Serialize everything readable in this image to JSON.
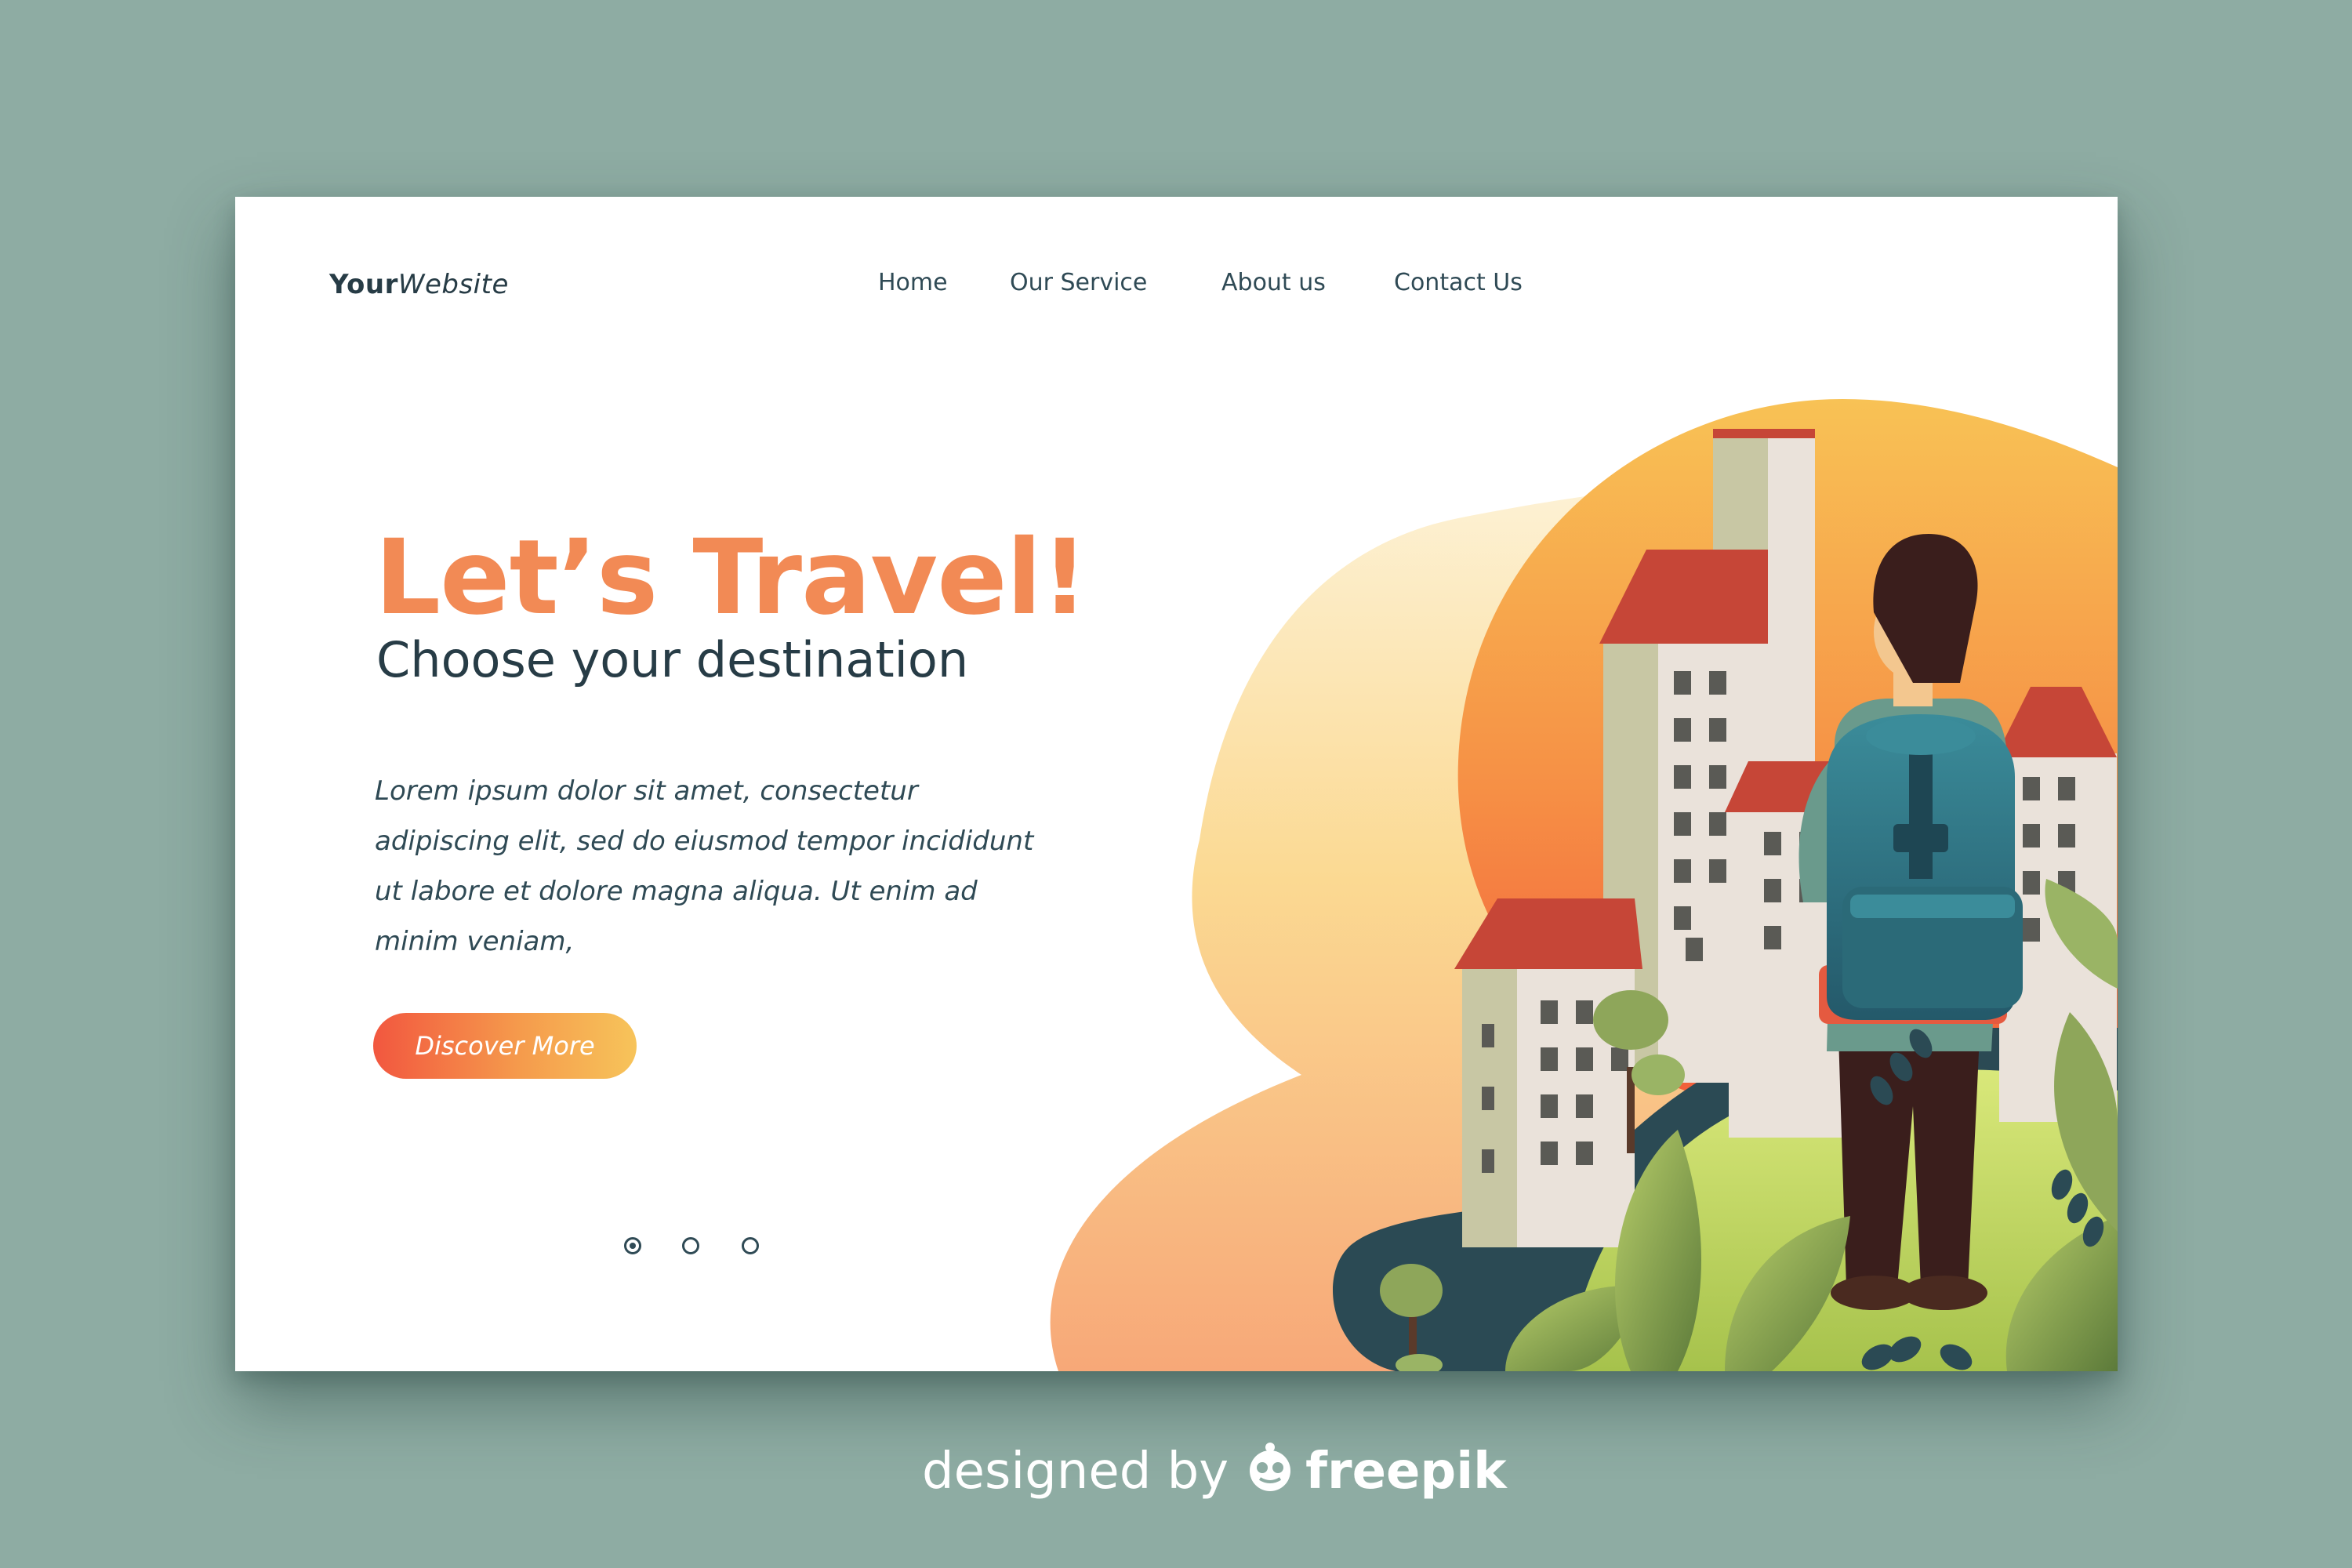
{
  "header": {
    "logo_bold": "Your",
    "logo_italic": "Website",
    "nav": [
      "Home",
      "Our Service",
      "About us",
      "Contact Us"
    ]
  },
  "hero": {
    "title": "Let’s Travel!",
    "subtitle": "Choose your destination",
    "body": "Lorem ipsum dolor sit amet, consectetur adipiscing elit, sed do eiusmod tempor incididunt ut labore et dolore magna aliqua. Ut enim ad minim veniam,",
    "cta": "Discover More"
  },
  "carousel": {
    "count": 3,
    "active_index": 0
  },
  "footer": {
    "credit_prefix": "designed by",
    "credit_brand": "freepik"
  },
  "colors": {
    "background": "#8eaca3",
    "accent_orange": "#f28a55",
    "text_dark": "#273c46",
    "cta_start": "#f2573f",
    "cta_end": "#f7c45a"
  },
  "icons": [
    "freepik-logo-icon",
    "traveler-backpack-illustration"
  ]
}
